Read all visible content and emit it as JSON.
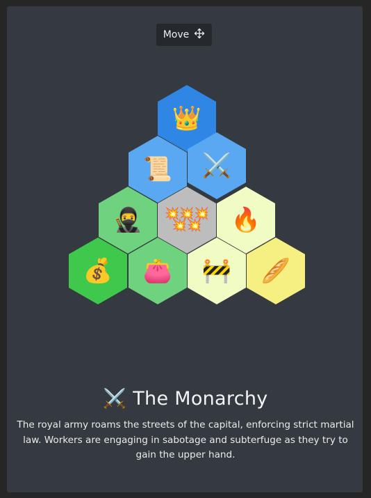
{
  "move_button": {
    "label": "Move",
    "icon": "move-arrows-icon"
  },
  "board": {
    "colors": {
      "blue": "#2f86e4",
      "light_blue": "#5aa7f2",
      "green": "#6fd27f",
      "bright_green": "#3ec94d",
      "gray": "#bdbdbd",
      "pale_yellow": "#f1fbc4",
      "yellow": "#f6ef82"
    },
    "tiles": [
      {
        "name": "crown-tile",
        "icon": "crown-icon",
        "emoji": "👑",
        "color": "#2f86e4"
      },
      {
        "name": "scroll-tile",
        "icon": "scroll-icon",
        "emoji": "📜",
        "color": "#5aa7f2"
      },
      {
        "name": "swords-tile",
        "icon": "crossed-swords-icon",
        "emoji": "⚔️",
        "color": "#5aa7f2"
      },
      {
        "name": "ninja-tile",
        "icon": "ninja-icon",
        "emoji": "🥷",
        "color": "#6fd27f"
      },
      {
        "name": "explosions-tile",
        "icon": "explosion-icon",
        "emoji": "💥💥💥\n💥💥",
        "color": "#bdbdbd"
      },
      {
        "name": "fire-tile",
        "icon": "fire-icon",
        "emoji": "🔥",
        "color": "#f1fbc4"
      },
      {
        "name": "money-bag-tile",
        "icon": "money-bag-icon",
        "emoji": "💰",
        "color": "#3ec94d"
      },
      {
        "name": "purse-tile",
        "icon": "purse-icon",
        "emoji": "👛",
        "color": "#6fd27f"
      },
      {
        "name": "barrier-tile",
        "icon": "construction-barrier-icon",
        "emoji": "🚧",
        "color": "#f1fbc4"
      },
      {
        "name": "bread-tile",
        "icon": "baguette-icon",
        "emoji": "🥖",
        "color": "#f6ef82"
      }
    ]
  },
  "scenario": {
    "icon": "crossed-swords-icon",
    "title_emoji": "⚔️",
    "title": "The Monarchy",
    "description": "The royal army roams the streets of the capital, enforcing strict martial law. Workers are engaging in sabotage and subterfuge as they try to gain the upper hand."
  }
}
